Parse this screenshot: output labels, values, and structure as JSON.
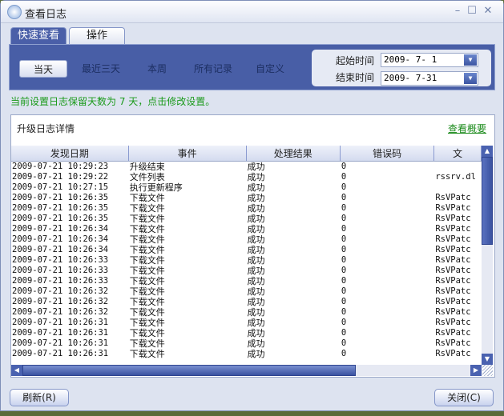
{
  "window": {
    "title": "查看日志",
    "minimize": "–",
    "maximize": "☐",
    "close": "✕"
  },
  "tabs": [
    {
      "label": "快速查看"
    },
    {
      "label": "操作"
    }
  ],
  "filters": [
    {
      "label": "当天"
    },
    {
      "label": "最近三天"
    },
    {
      "label": "本周"
    },
    {
      "label": "所有记录"
    },
    {
      "label": "自定义"
    }
  ],
  "dates": {
    "start_label": "起始时间",
    "start_value": "2009- 7- 1",
    "end_label": "结束时间",
    "end_value": "2009- 7-31"
  },
  "notice": "当前设置日志保留天数为 7 天，点击修改设置。",
  "detail": {
    "title": "升级日志详情",
    "summary_link": "查看概要"
  },
  "table": {
    "columns": [
      "发现日期",
      "事件",
      "处理结果",
      "错误码",
      "文"
    ],
    "rows": [
      [
        "2009-07-21 10:29:23",
        "升级结束",
        "成功",
        "0",
        ""
      ],
      [
        "2009-07-21 10:29:22",
        "文件列表",
        "成功",
        "0",
        "rssrv.dl"
      ],
      [
        "2009-07-21 10:27:15",
        "执行更新程序",
        "成功",
        "0",
        ""
      ],
      [
        "2009-07-21 10:26:35",
        "下载文件",
        "成功",
        "0",
        "RsVPatc"
      ],
      [
        "2009-07-21 10:26:35",
        "下载文件",
        "成功",
        "0",
        "RsVPatc"
      ],
      [
        "2009-07-21 10:26:35",
        "下载文件",
        "成功",
        "0",
        "RsVPatc"
      ],
      [
        "2009-07-21 10:26:34",
        "下载文件",
        "成功",
        "0",
        "RsVPatc"
      ],
      [
        "2009-07-21 10:26:34",
        "下载文件",
        "成功",
        "0",
        "RsVPatc"
      ],
      [
        "2009-07-21 10:26:34",
        "下载文件",
        "成功",
        "0",
        "RsVPatc"
      ],
      [
        "2009-07-21 10:26:33",
        "下载文件",
        "成功",
        "0",
        "RsVPatc"
      ],
      [
        "2009-07-21 10:26:33",
        "下载文件",
        "成功",
        "0",
        "RsVPatc"
      ],
      [
        "2009-07-21 10:26:33",
        "下载文件",
        "成功",
        "0",
        "RsVPatc"
      ],
      [
        "2009-07-21 10:26:32",
        "下载文件",
        "成功",
        "0",
        "RsVPatc"
      ],
      [
        "2009-07-21 10:26:32",
        "下载文件",
        "成功",
        "0",
        "RsVPatc"
      ],
      [
        "2009-07-21 10:26:32",
        "下载文件",
        "成功",
        "0",
        "RsVPatc"
      ],
      [
        "2009-07-21 10:26:31",
        "下载文件",
        "成功",
        "0",
        "RsVPatc"
      ],
      [
        "2009-07-21 10:26:31",
        "下载文件",
        "成功",
        "0",
        "RsVPatc"
      ],
      [
        "2009-07-21 10:26:31",
        "下载文件",
        "成功",
        "0",
        "RsVPatc"
      ],
      [
        "2009-07-21 10:26:31",
        "下载文件",
        "成功",
        "0",
        "RsVPatc"
      ]
    ]
  },
  "buttons": {
    "refresh": "刷新(R)",
    "close": "关闭(C)"
  }
}
